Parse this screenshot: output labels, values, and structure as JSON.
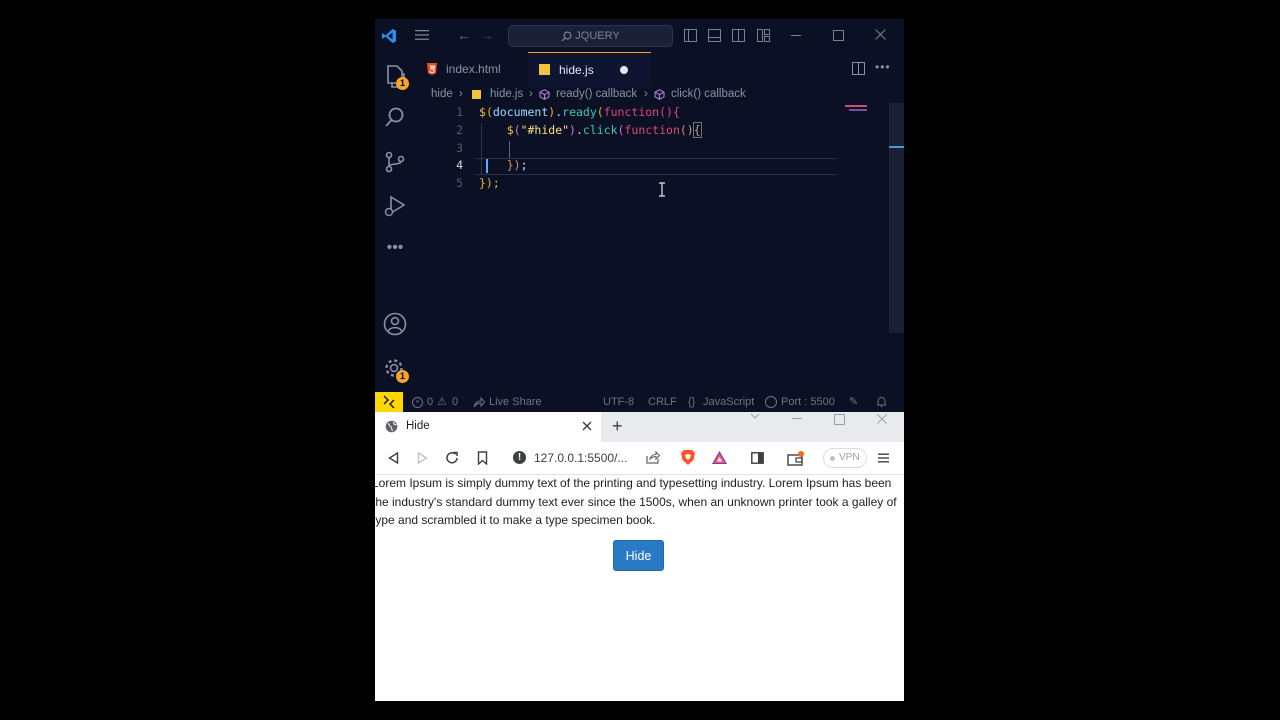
{
  "vscode": {
    "search_text": "JQUERY",
    "tabs": [
      {
        "label": "index.html"
      },
      {
        "label": "hide.js"
      }
    ],
    "breadcrumb": {
      "folder": "hide",
      "file": "hide.js",
      "symbol1": "ready() callback",
      "symbol2": "click() callback"
    },
    "line_numbers": [
      "1",
      "2",
      "3",
      "4",
      "5"
    ],
    "code": {
      "l1": {
        "dollar": "$",
        "p1": "(",
        "doc": "document",
        "p2": ")",
        "dot": ".",
        "fn": "ready",
        "p3": "(",
        "kw": "function",
        "p4": "(){"
      },
      "l2": {
        "dollar": "$",
        "p1": "(",
        "str": "\"#hide\"",
        "p2": ")",
        "dot": ".",
        "fn": "click",
        "p3": "(",
        "kw": "function",
        "p4": "()",
        "brace": "{"
      },
      "l4": {
        "close": "})",
        "semi": ";"
      },
      "l5": {
        "close": "});"
      }
    },
    "activity_badges": {
      "explorer": "1",
      "settings": "1"
    },
    "status": {
      "errors": "0",
      "warnings": "0",
      "live_share": "Live Share",
      "encoding": "UTF-8",
      "eol": "CRLF",
      "language": "JavaScript",
      "port": "Port : 5500"
    },
    "colors": {
      "accent": "#ffd700",
      "tab_active_border": "#f5a623",
      "bg": "#0b1024"
    }
  },
  "browser": {
    "tab_title": "Hide",
    "url": "127.0.0.1:5500/...",
    "vpn_label": "VPN",
    "page": {
      "paragraph": "Lorem Ipsum is simply dummy text of the printing and typesetting industry. Lorem Ipsum has been the industry's standard dummy text ever since the 1500s, when an unknown printer took a galley of type and scrambled it to make a type specimen book.",
      "button_label": "Hide"
    },
    "colors": {
      "button_bg": "#2a79c4"
    }
  }
}
